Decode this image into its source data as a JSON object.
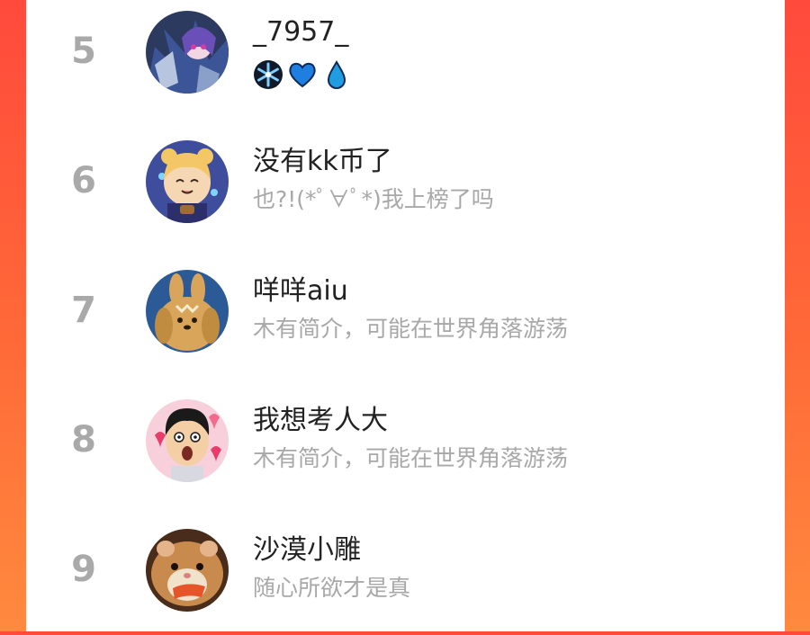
{
  "colors": {
    "background_gradient_top": "#ff4a3c",
    "background_gradient_bottom": "#ff8a3e",
    "panel": "#ffffff",
    "rank": "#a9a9a9",
    "name": "#222222",
    "bio": "#a8a8a8",
    "badge_blue": "#1f7fe0"
  },
  "leaderboard": {
    "rows": [
      {
        "rank": "5",
        "name": "_7957_",
        "bio": "",
        "badges": [
          "snowflake-icon",
          "heart-icon",
          "water-drop-icon"
        ]
      },
      {
        "rank": "6",
        "name": "没有kk币了",
        "bio": "也?!(*ﾟ∀ﾟ*)我上榜了吗"
      },
      {
        "rank": "7",
        "name": "咩咩aiu",
        "bio": "木有简介，可能在世界角落游荡"
      },
      {
        "rank": "8",
        "name": "我想考人大",
        "bio": "木有简介，可能在世界角落游荡"
      },
      {
        "rank": "9",
        "name": "沙漠小雕",
        "bio": "随心所欲才是真"
      }
    ]
  }
}
